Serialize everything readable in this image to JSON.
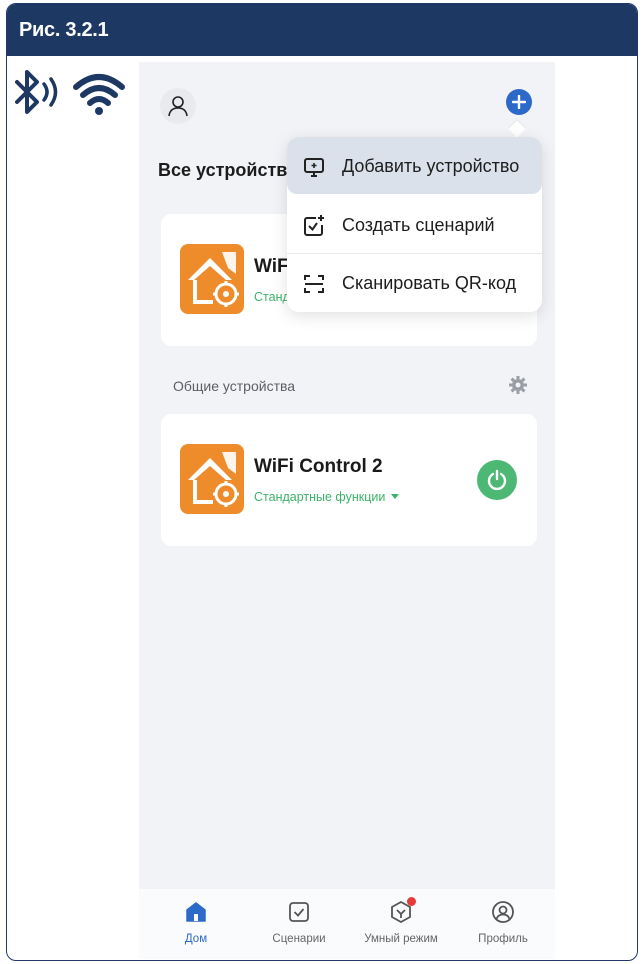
{
  "figure": {
    "title": "Рис. 3.2.1"
  },
  "connectivity": {
    "icons": [
      "bluetooth-icon",
      "wifi-icon"
    ]
  },
  "header": {
    "add_icon": "plus-icon",
    "profile_icon": "user-icon"
  },
  "home": {
    "section_title": "Все устройства"
  },
  "add_menu": {
    "items": [
      {
        "label": "Добавить устройство",
        "icon": "add-device-icon",
        "active": true
      },
      {
        "label": "Создать сценарий",
        "icon": "create-scenario-icon",
        "active": false
      },
      {
        "label": "Сканировать QR-код",
        "icon": "scan-icon",
        "active": false
      }
    ]
  },
  "devices": [
    {
      "name": "WiFi Control",
      "name_visible": "WiF",
      "status": "Стандартные функции",
      "status_visible": "Станд"
    }
  ],
  "shared": {
    "label": "Общие устройства",
    "devices": [
      {
        "name": "WiFi Control 2",
        "status": "Стандартные функции"
      }
    ]
  },
  "tabbar": {
    "tabs": [
      {
        "label": "Дом",
        "icon": "home-icon",
        "active": true
      },
      {
        "label": "Сценарии",
        "icon": "scenarios-icon",
        "active": false
      },
      {
        "label": "Умный режим",
        "icon": "smart-mode-icon",
        "active": false,
        "badge": true
      },
      {
        "label": "Профиль",
        "icon": "profile-icon",
        "active": false
      }
    ]
  },
  "colors": {
    "header_bg": "#1e3864",
    "accent": "#2c69c9",
    "device_icon": "#ee8c2c",
    "power_green": "#4cb873",
    "status_green": "#3bb36a",
    "badge_red": "#e63b3b"
  }
}
